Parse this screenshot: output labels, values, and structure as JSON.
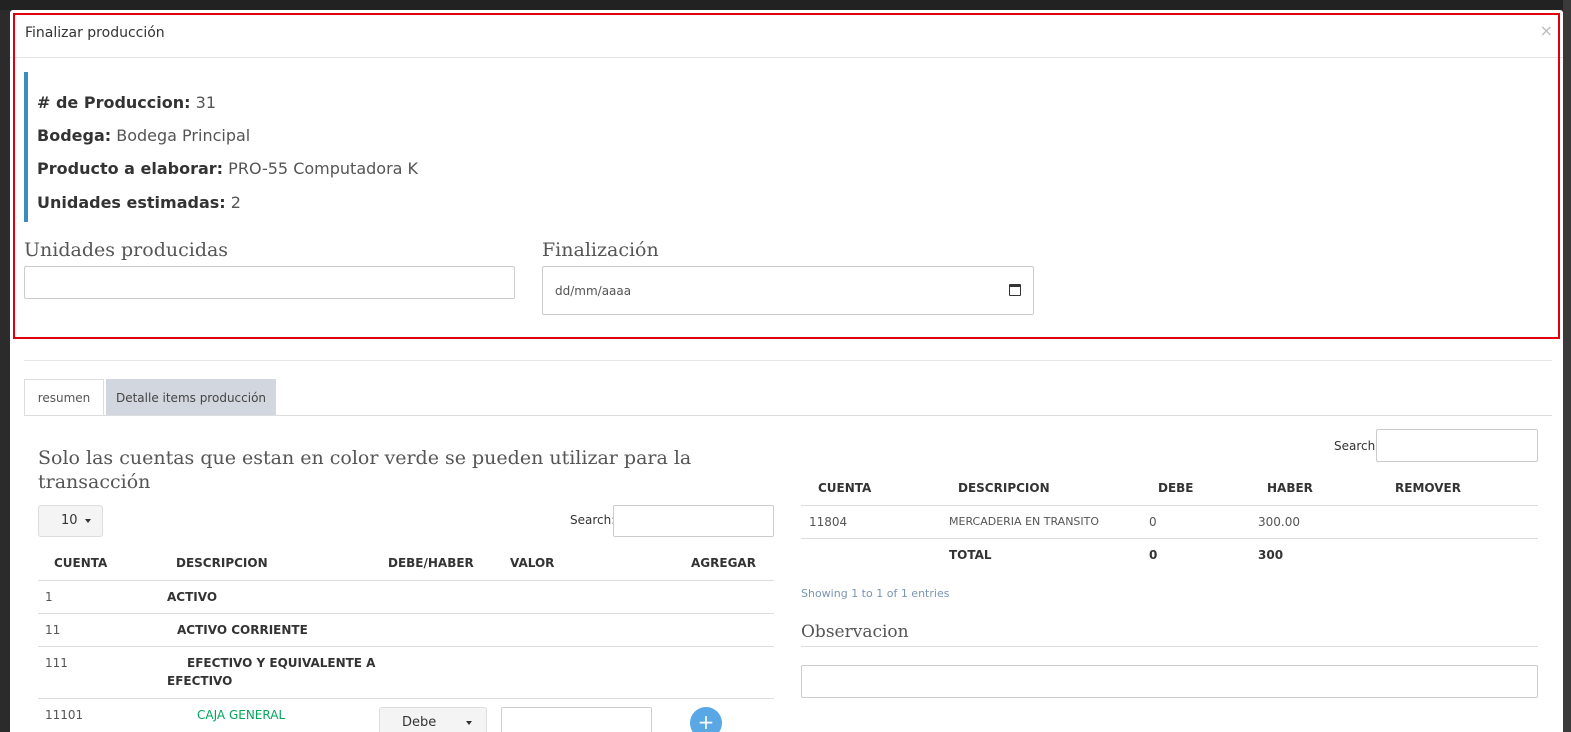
{
  "modal": {
    "title": "Finalizar producción",
    "close": "×"
  },
  "info": {
    "produccion_label": "# de Produccion:",
    "produccion_value": "31",
    "bodega_label": "Bodega:",
    "bodega_value": "Bodega Principal",
    "producto_label": "Producto a elaborar:",
    "producto_value": "PRO-55 Computadora K",
    "unidades_label": "Unidades estimadas:",
    "unidades_value": "2"
  },
  "form": {
    "unidades_producidas_label": "Unidades producidas",
    "unidades_producidas_value": "",
    "finalizacion_label": "Finalización",
    "finalizacion_placeholder": "dd/mm/aaaa"
  },
  "tabs": [
    {
      "label": "resumen",
      "active": true
    },
    {
      "label": "Detalle items producción",
      "active": false
    }
  ],
  "left": {
    "title": "Solo las cuentas que estan en color verde se pueden utilizar para la transacción",
    "page_length": "10",
    "search_label": "Search:",
    "columns": [
      "CUENTA",
      "DESCRIPCION",
      "DEBE/HABER",
      "VALOR",
      "AGREGAR"
    ],
    "rows": [
      {
        "cuenta": "1",
        "descripcion": "ACTIVO"
      },
      {
        "cuenta": "11",
        "descripcion": "ACTIVO CORRIENTE"
      },
      {
        "cuenta": "111",
        "descripcion_1": "EFECTIVO Y EQUIVALENTE A",
        "descripcion_2": "EFECTIVO"
      },
      {
        "cuenta": "11101",
        "descripcion": "CAJA GENERAL",
        "debe_haber": "Debe",
        "add": "+"
      }
    ]
  },
  "right": {
    "search_label": "Search:",
    "columns": [
      "CUENTA",
      "DESCRIPCION",
      "DEBE",
      "HABER",
      "REMOVER"
    ],
    "rows": [
      {
        "cuenta": "11804",
        "descripcion": "MERCADERIA EN TRANSITO",
        "debe": "0",
        "haber": "300.00"
      }
    ],
    "total": {
      "label": "TOTAL",
      "debe": "0",
      "haber": "300"
    },
    "info": "Showing 1 to 1 of 1 entries",
    "observacion_label": "Observacion"
  },
  "colors": {
    "accent": "#3c8dbc",
    "highlight_frame": "#e0000b",
    "usable_account": "#00a65a",
    "add_button": "#5aa7e6"
  }
}
